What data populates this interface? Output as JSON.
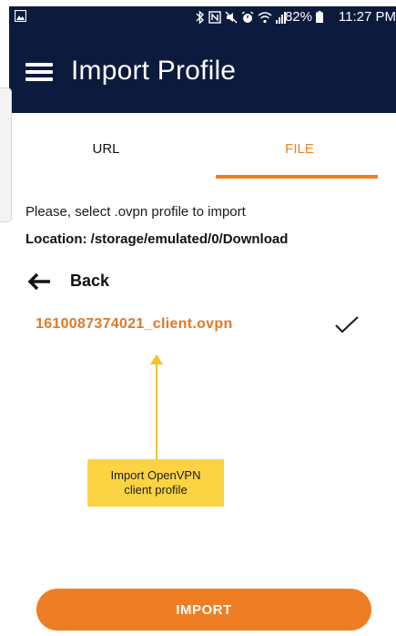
{
  "status_bar": {
    "battery_percent": "82%",
    "time": "11:27 PM",
    "icons": [
      "gallery-icon",
      "bluetooth-icon",
      "nfc-icon",
      "mute-icon",
      "alarm-icon",
      "wifi-icon",
      "signal-icon",
      "battery-icon"
    ]
  },
  "app_bar": {
    "title": "Import Profile",
    "menu_icon": "hamburger-menu-icon"
  },
  "tabs": [
    {
      "label": "URL",
      "active": false
    },
    {
      "label": "FILE",
      "active": true
    }
  ],
  "content": {
    "instruction": "Please, select .ovpn profile to import",
    "location": "Location: /storage/emulated/0/Download",
    "back_label": "Back",
    "files": [
      {
        "name": "1610087374021_client.ovpn",
        "selected": true
      }
    ]
  },
  "annotation": {
    "line1": "Import OpenVPN",
    "line2": "client profile"
  },
  "import_button": {
    "label": "IMPORT"
  },
  "colors": {
    "app_bar": "#0c1b3d",
    "accent": "#ef7d23",
    "annotation": "#fcd343"
  }
}
